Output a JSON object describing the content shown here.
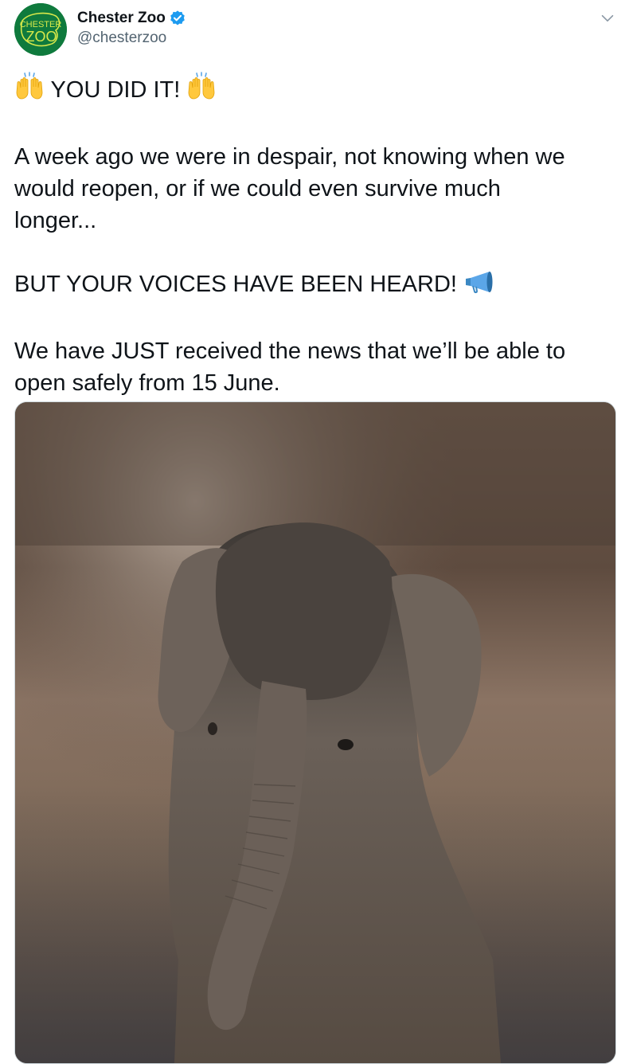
{
  "tweet": {
    "author": {
      "display_name": "Chester Zoo",
      "handle": "@chesterzoo",
      "verified": true,
      "avatar_logo_text": [
        "CHESTER",
        "ZOO"
      ],
      "avatar_color": "#0f7a3d",
      "avatar_logo_color": "#d7e84a"
    },
    "body": {
      "line1": "YOU DID IT!",
      "para2": [
        "A week ago we were in despair, not knowing when we",
        "would reopen, or if we could even survive much",
        "longer..."
      ],
      "line3": "BUT YOUR VOICES HAVE BEEN HEARD!",
      "para4": [
        "We have JUST received the news that we’ll be able to",
        "open safely from 15 June."
      ]
    },
    "icons": {
      "raising_hands": "raising-hands-icon",
      "megaphone": "megaphone-icon",
      "verified": "verified-badge-icon",
      "menu": "chevron-down-icon"
    },
    "media": {
      "subject": "baby-elephant-photo"
    },
    "colors": {
      "verified_blue": "#1d9bf0",
      "text": "#0f1419",
      "secondary_text": "#536471",
      "border": "#cfd9de"
    }
  }
}
